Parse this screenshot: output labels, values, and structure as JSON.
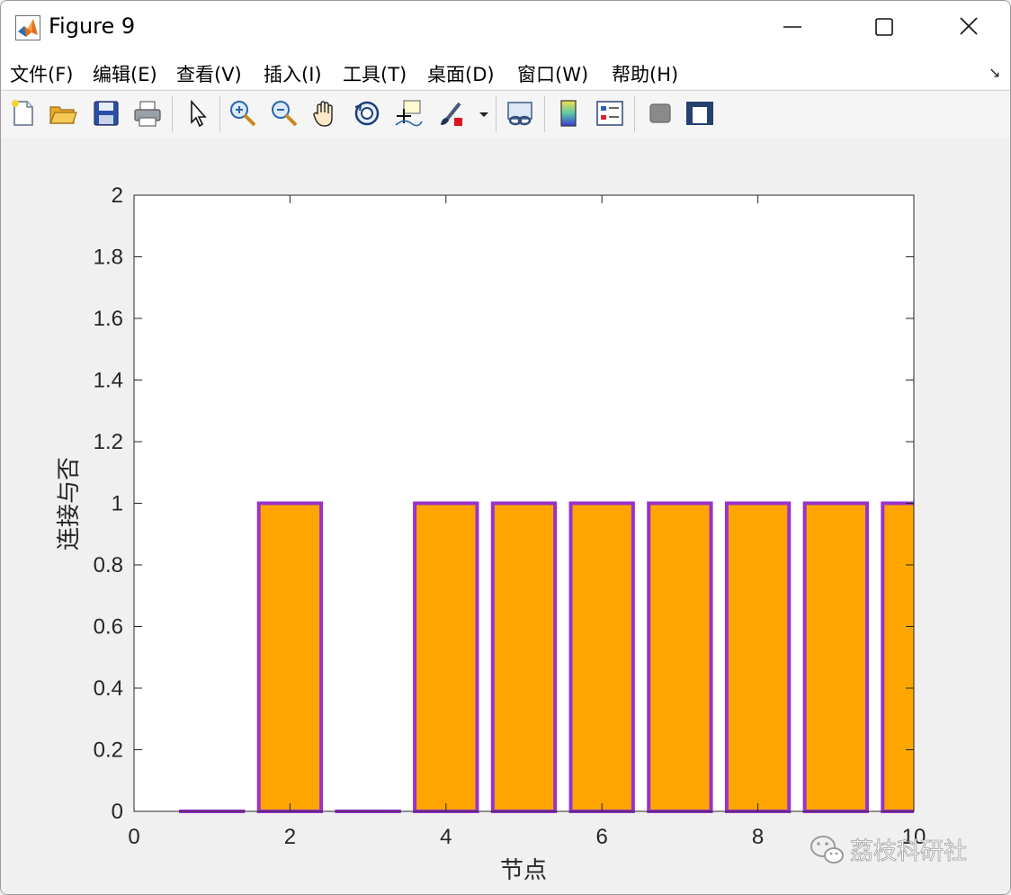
{
  "window": {
    "title": "Figure 9"
  },
  "menubar": {
    "items": [
      "文件(F)",
      "编辑(E)",
      "查看(V)",
      "插入(I)",
      "工具(T)",
      "桌面(D)",
      "窗口(W)",
      "帮助(H)"
    ]
  },
  "toolbar": {
    "buttons": [
      "new-figure-icon",
      "open-icon",
      "save-icon",
      "print-icon",
      "select-pointer-icon",
      "zoom-in-icon",
      "zoom-out-icon",
      "pan-hand-icon",
      "rotate-3d-icon",
      "data-cursor-icon",
      "brush-icon",
      "brush-dropdown-icon",
      "link-plot-icon",
      "colorbar-icon",
      "legend-icon",
      "hide-plot-tools-icon",
      "show-plot-tools-icon"
    ]
  },
  "chart_data": {
    "type": "bar",
    "x": [
      1,
      2,
      3,
      4,
      5,
      6,
      7,
      8,
      9,
      10
    ],
    "values": [
      0,
      1,
      0,
      1,
      1,
      1,
      1,
      1,
      1,
      1
    ],
    "xlabel": "节点",
    "ylabel": "连接与否",
    "xlim": [
      0,
      10
    ],
    "ylim": [
      0,
      2
    ],
    "xticks": [
      "0",
      "2",
      "4",
      "6",
      "8",
      "10"
    ],
    "yticks": [
      "0",
      "0.2",
      "0.4",
      "0.6",
      "0.8",
      "1",
      "1.2",
      "1.4",
      "1.6",
      "1.8",
      "2"
    ],
    "bar_width": 0.8,
    "colors": {
      "fill": "#ffa500",
      "edge": "#9932cc"
    },
    "grid": false
  },
  "watermark": {
    "text": "荔枝科研社"
  }
}
